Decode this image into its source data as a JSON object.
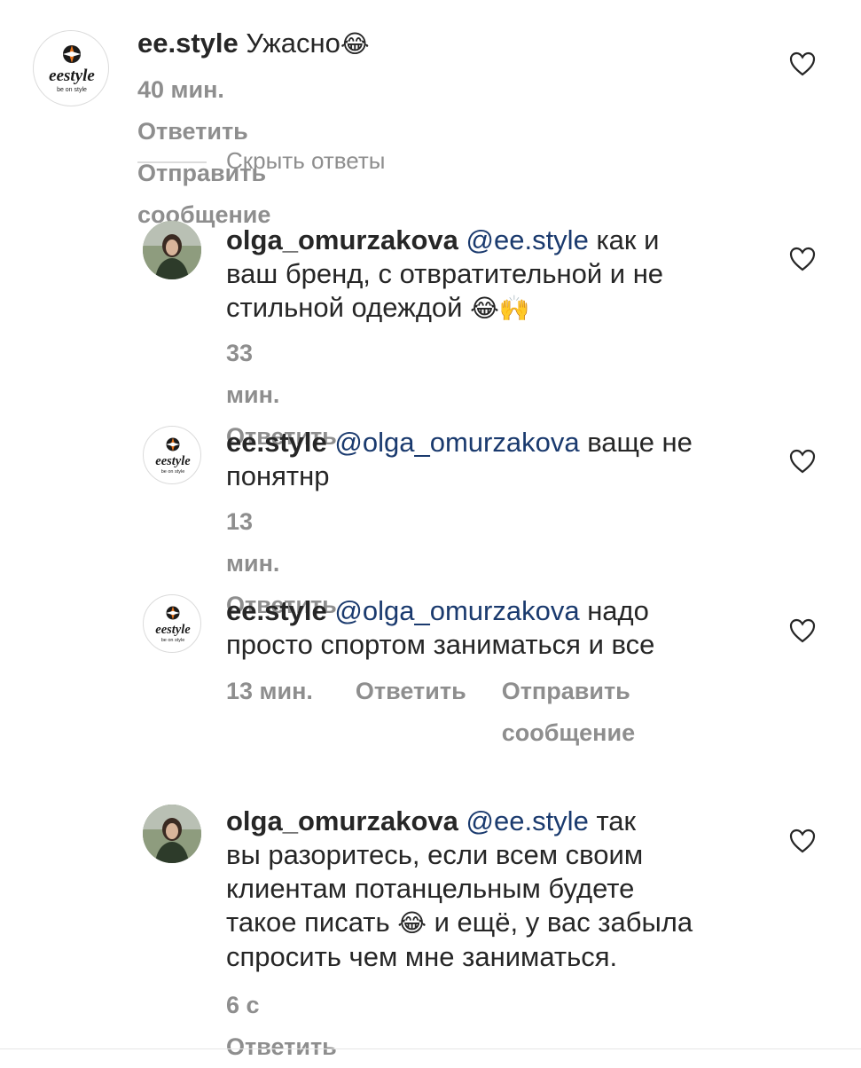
{
  "comments": [
    {
      "username": "ee.style",
      "text": "Ужасно",
      "emoji": "😂",
      "time": "40 мин.",
      "reply": "Ответить",
      "send": "Отправить сообщение"
    },
    {
      "username": "olga_omurzakova",
      "mention": "@ee.style",
      "text_a": "как и",
      "text_b": "ваш бренд, с отвратительной и не",
      "text_c": "стильной одеждой",
      "emoji": "😂🙌",
      "time": "33 мин.",
      "reply": "Ответить"
    },
    {
      "username": "ee.style",
      "mention": "@olga_omurzakova",
      "text_a": "ваще не",
      "text_b": "понятнр",
      "time": "13 мин.",
      "reply": "Ответить"
    },
    {
      "username": "ee.style",
      "mention": "@olga_omurzakova",
      "text_a": "надо",
      "text_b": "просто спортом заниматься и все",
      "time": "13 мин.",
      "reply": "Ответить",
      "send_a": "Отправить",
      "send_b": "сообщение"
    },
    {
      "username": "olga_omurzakova",
      "mention": "@ee.style",
      "text_a": "так",
      "text_b": "вы разоритесь, если всем своим",
      "text_c": "клиентам потанцельным будете",
      "text_d": "такое писать",
      "emoji": "😂",
      "text_e": "и ещё, у вас забыла",
      "text_f": "спросить чем мне заниматься.",
      "time": "6 с",
      "reply": "Ответить"
    }
  ],
  "hide_replies": "Скрыть ответы",
  "brand_logo": {
    "name": "eestyle",
    "tagline": "be on style",
    "accent": "#e8731a"
  },
  "colors": {
    "text": "#262626",
    "meta": "#8e8e8e",
    "mention": "#1a3a6e"
  }
}
